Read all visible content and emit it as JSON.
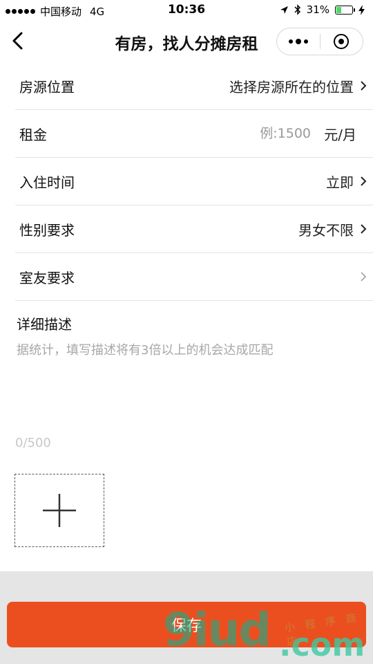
{
  "status_bar": {
    "carrier": "中国移动",
    "network": "4G",
    "time": "10:36",
    "battery": "31%",
    "battery_level": 0.31
  },
  "nav": {
    "title": "有房，找人分摊房租"
  },
  "form": {
    "location": {
      "label": "房源位置",
      "value": "选择房源所在的位置"
    },
    "rent": {
      "label": "租金",
      "placeholder": "例:1500",
      "unit": "元/月"
    },
    "move_in": {
      "label": "入住时间",
      "value": "立即"
    },
    "gender": {
      "label": "性别要求",
      "value": "男女不限"
    },
    "roommate": {
      "label": "室友要求",
      "value": ""
    }
  },
  "description": {
    "title": "详细描述",
    "placeholder": "据统计，填写描述将有3倍以上的机会达成匹配",
    "counter": "0/500"
  },
  "save_label": "保存",
  "watermark": {
    "main": "9iud",
    "suffix": ".com",
    "small": "小 程 序 商 店"
  },
  "colors": {
    "accent": "#ec4f1f",
    "battery": "#4cd964"
  }
}
